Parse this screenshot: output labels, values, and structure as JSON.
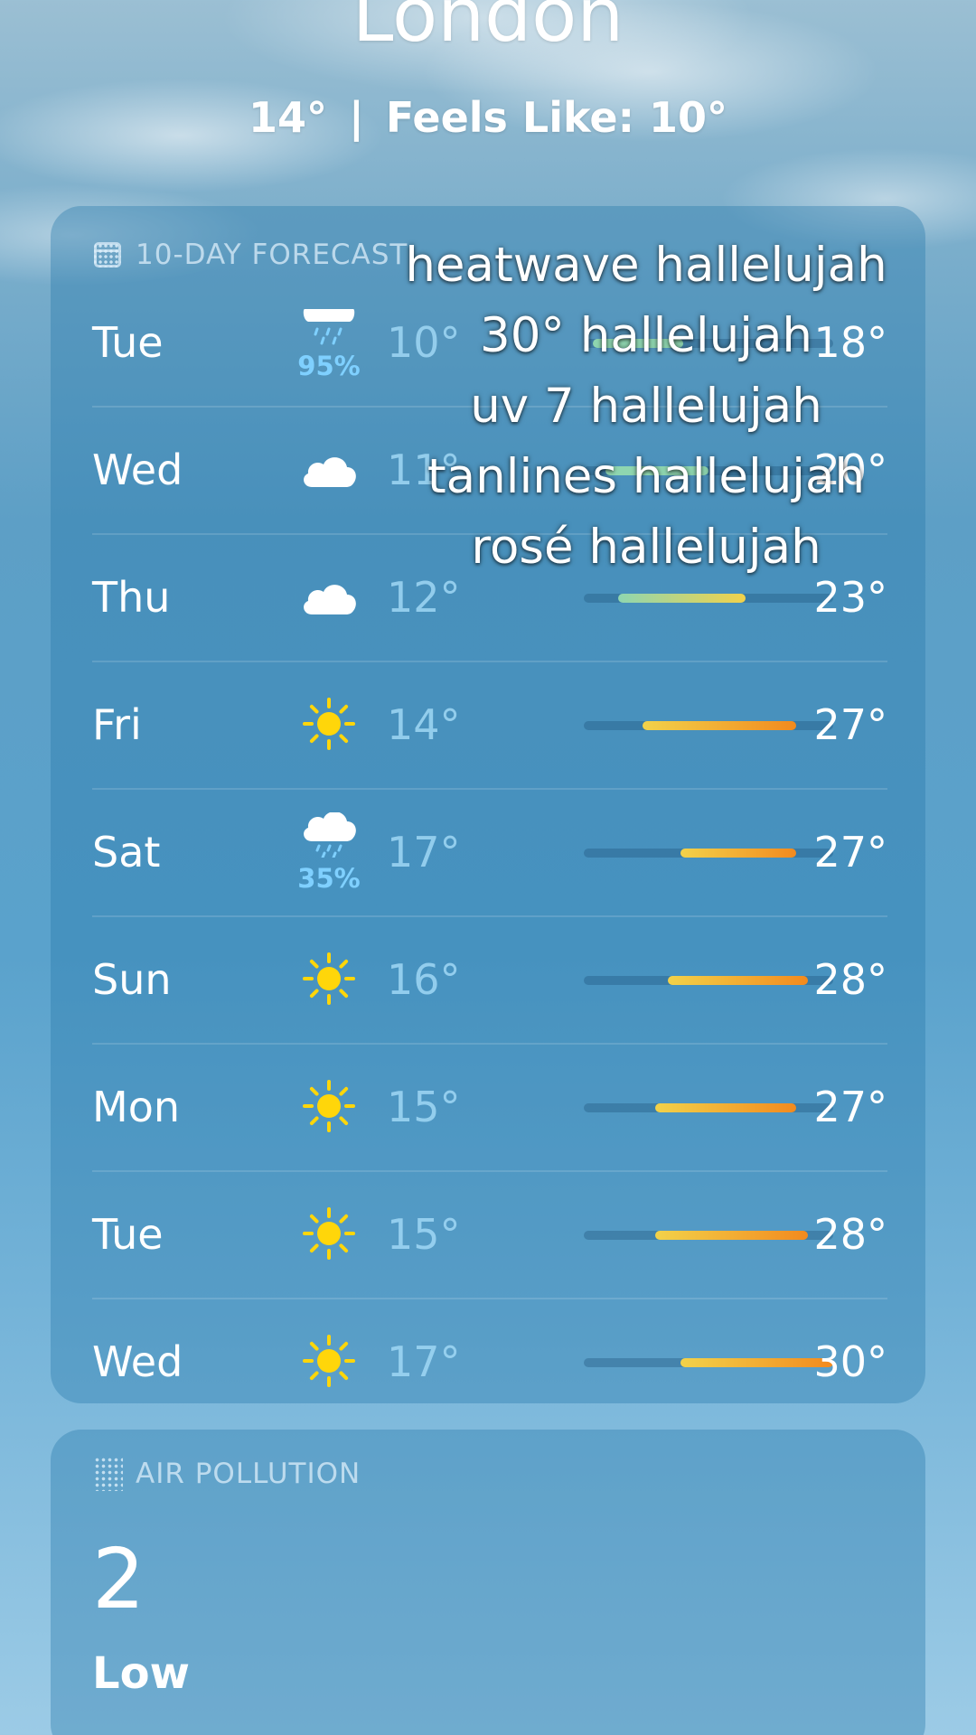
{
  "header": {
    "city": "London",
    "temp": "14°",
    "separator": "|",
    "feels_like": "Feels Like: 10°"
  },
  "forecast": {
    "title": "10-DAY FORECAST",
    "icon": "calendar-icon",
    "scale_min": 10,
    "scale_max": 30,
    "days": [
      {
        "day": "Tue",
        "icon": "rain-icon",
        "precip": "95%",
        "low": "10°",
        "high": "18°",
        "low_val": 10,
        "high_val": 18
      },
      {
        "day": "Wed",
        "icon": "cloud-icon",
        "precip": "",
        "low": "11°",
        "high": "20°",
        "low_val": 11,
        "high_val": 20
      },
      {
        "day": "Thu",
        "icon": "cloud-icon",
        "precip": "",
        "low": "12°",
        "high": "23°",
        "low_val": 12,
        "high_val": 23
      },
      {
        "day": "Fri",
        "icon": "sun-icon",
        "precip": "",
        "low": "14°",
        "high": "27°",
        "low_val": 14,
        "high_val": 27
      },
      {
        "day": "Sat",
        "icon": "cloud-rain-icon",
        "precip": "35%",
        "low": "17°",
        "high": "27°",
        "low_val": 17,
        "high_val": 27
      },
      {
        "day": "Sun",
        "icon": "sun-icon",
        "precip": "",
        "low": "16°",
        "high": "28°",
        "low_val": 16,
        "high_val": 28
      },
      {
        "day": "Mon",
        "icon": "sun-icon",
        "precip": "",
        "low": "15°",
        "high": "27°",
        "low_val": 15,
        "high_val": 27
      },
      {
        "day": "Tue",
        "icon": "sun-icon",
        "precip": "",
        "low": "15°",
        "high": "28°",
        "low_val": 15,
        "high_val": 28
      },
      {
        "day": "Wed",
        "icon": "sun-icon",
        "precip": "",
        "low": "17°",
        "high": "30°",
        "low_val": 17,
        "high_val": 30
      }
    ]
  },
  "overlay_text": {
    "lines": [
      "heatwave hallelujah",
      "30° hallelujah",
      "uv 7 hallelujah",
      "tanlines hallelujah",
      "rosé hallelujah"
    ]
  },
  "air_pollution": {
    "title": "AIR POLLUTION",
    "icon": "air-dots-icon",
    "value": "2",
    "label": "Low"
  },
  "colors": {
    "sun": "#ffd60a",
    "precip": "#7fd0ff",
    "bar_cool": "#8fd6b0",
    "bar_warm": "#f2d24a",
    "bar_hot": "#f28a1e"
  }
}
